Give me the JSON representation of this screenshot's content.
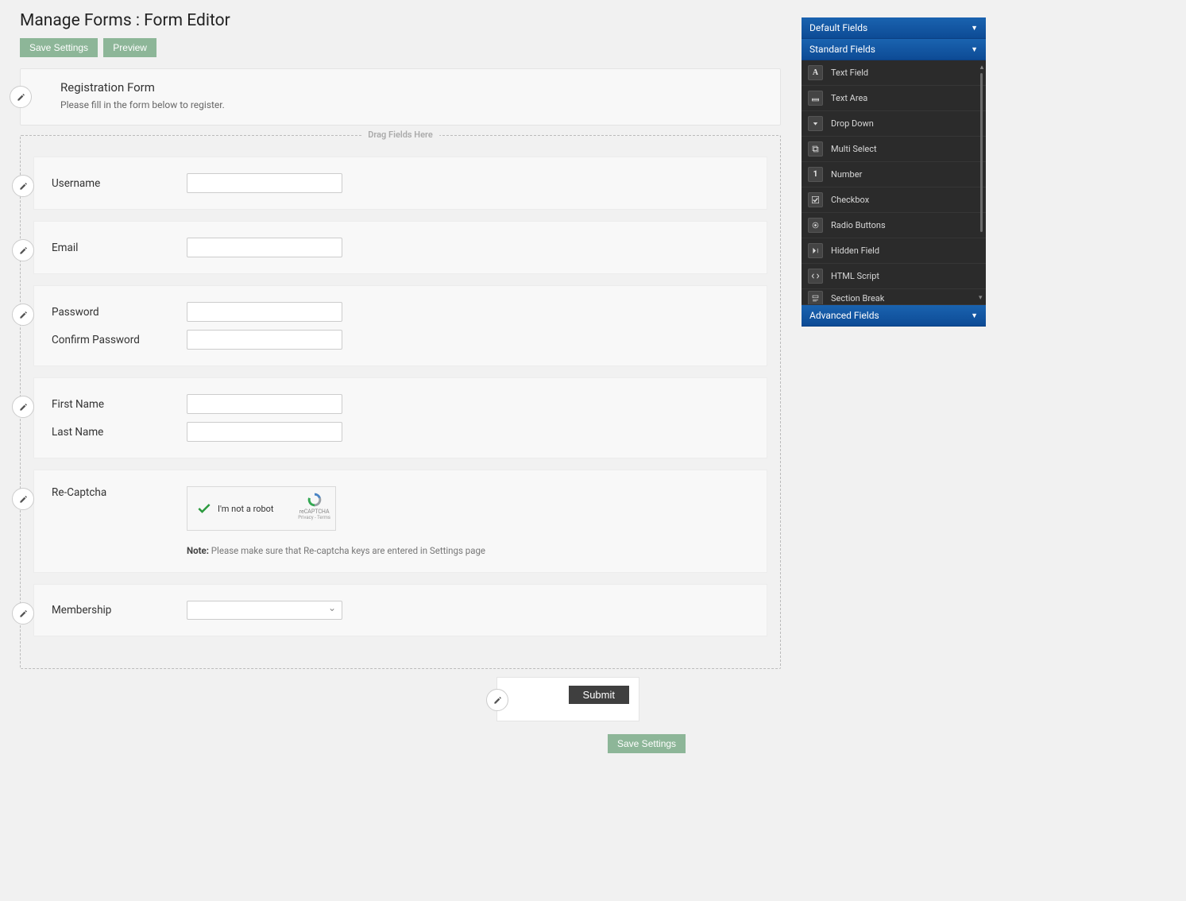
{
  "page_title": "Manage Forms : Form Editor",
  "buttons": {
    "save_top": "Save Settings",
    "preview": "Preview",
    "save_bottom": "Save Settings",
    "submit": "Submit"
  },
  "form_header": {
    "title": "Registration Form",
    "subtitle": "Please fill in the form below to register."
  },
  "drop_label": "Drag Fields Here",
  "fields": {
    "username": {
      "label": "Username"
    },
    "email": {
      "label": "Email"
    },
    "password": {
      "label": "Password",
      "confirm_label": "Confirm Password"
    },
    "first_name": {
      "label": "First Name",
      "last_label": "Last Name"
    },
    "recaptcha": {
      "label": "Re-Captcha",
      "not_robot": "I'm not a robot",
      "logo_text": "reCAPTCHA",
      "logo_links": "Privacy - Terms",
      "note_prefix": "Note:",
      "note_text": " Please make sure that Re-captcha keys are entered in Settings page"
    },
    "membership": {
      "label": "Membership"
    }
  },
  "panel": {
    "default_head": "Default Fields",
    "standard_head": "Standard Fields",
    "advanced_head": "Advanced Fields",
    "standard_items": [
      {
        "icon": "A",
        "label": "Text Field"
      },
      {
        "icon": "textarea",
        "label": "Text Area"
      },
      {
        "icon": "dropdown",
        "label": "Drop Down"
      },
      {
        "icon": "multi",
        "label": "Multi Select"
      },
      {
        "icon": "1",
        "label": "Number"
      },
      {
        "icon": "check",
        "label": "Checkbox"
      },
      {
        "icon": "radio",
        "label": "Radio Buttons"
      },
      {
        "icon": "hidden",
        "label": "Hidden Field"
      },
      {
        "icon": "html",
        "label": "HTML Script"
      },
      {
        "icon": "section",
        "label": "Section Break"
      }
    ]
  }
}
